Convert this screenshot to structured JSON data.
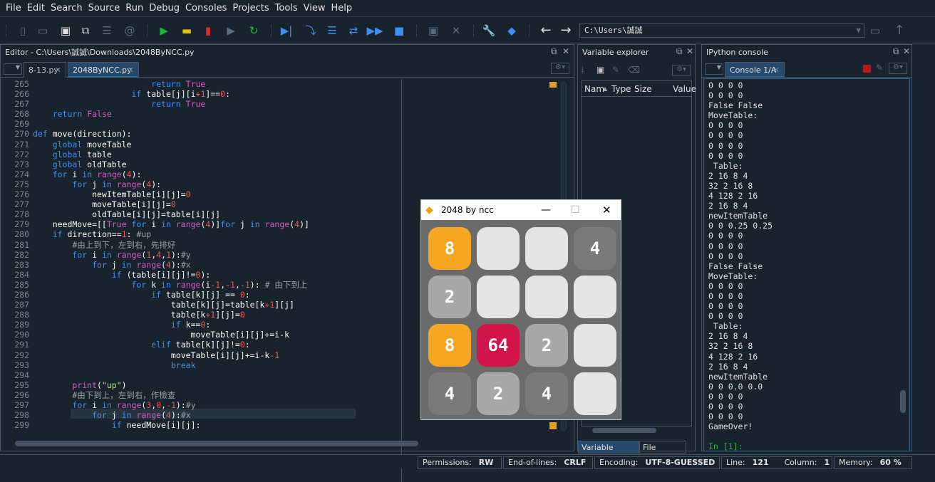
{
  "menu": [
    "File",
    "Edit",
    "Search",
    "Source",
    "Run",
    "Debug",
    "Consoles",
    "Projects",
    "Tools",
    "View",
    "Help"
  ],
  "toolbar": {
    "path": "C:\\Users\\誠誠"
  },
  "editor": {
    "title": "Editor - C:\\Users\\誠誠\\Downloads\\2048ByNCC.py",
    "tabs": [
      {
        "label": "8-13.py"
      },
      {
        "label": "2048ByNCC.py"
      }
    ],
    "lines": [
      {
        "n": "265",
        "t": "                        return True"
      },
      {
        "n": "266",
        "t": "                    if table[j][i+1]==0:"
      },
      {
        "n": "267",
        "t": "                        return True"
      },
      {
        "n": "268",
        "t": "    return False"
      },
      {
        "n": "269",
        "t": ""
      },
      {
        "n": "270",
        "t": "def move(direction):"
      },
      {
        "n": "271",
        "t": "    global moveTable"
      },
      {
        "n": "272",
        "t": "    global table"
      },
      {
        "n": "273",
        "t": "    global oldTable"
      },
      {
        "n": "274",
        "t": "    for i in range(4):"
      },
      {
        "n": "275",
        "t": "        for j in range(4):"
      },
      {
        "n": "276",
        "t": "            newItemTable[i][j]=0"
      },
      {
        "n": "277",
        "t": "            moveTable[i][j]=0"
      },
      {
        "n": "278",
        "t": "            oldTable[i][j]=table[i][j]"
      },
      {
        "n": "279",
        "t": "    needMove=[[True for i in range(4)]for j in range(4)]"
      },
      {
        "n": "280",
        "t": "    if direction==1: #up"
      },
      {
        "n": "281",
        "t": "        #由上到下，左到右，先排好"
      },
      {
        "n": "282",
        "t": "        for i in range(1,4,1):#y"
      },
      {
        "n": "283",
        "t": "            for j in range(4):#x"
      },
      {
        "n": "284",
        "t": "                if (table[i][j]!=0):"
      },
      {
        "n": "285",
        "t": "                    for k in range(i-1,-1,-1): # 由下到上"
      },
      {
        "n": "286",
        "t": "                        if table[k][j] == 0:"
      },
      {
        "n": "287",
        "t": "                            table[k][j]=table[k+1][j]"
      },
      {
        "n": "288",
        "t": "                            table[k+1][j]=0"
      },
      {
        "n": "289",
        "t": "                            if k==0:"
      },
      {
        "n": "290",
        "t": "                                moveTable[i][j]+=i-k"
      },
      {
        "n": "291",
        "t": "                        elif table[k][j]!=0:"
      },
      {
        "n": "292",
        "t": "                            moveTable[i][j]+=i-k-1"
      },
      {
        "n": "293",
        "t": "                            break"
      },
      {
        "n": "294",
        "t": ""
      },
      {
        "n": "295",
        "t": "        print(\"up\")"
      },
      {
        "n": "296",
        "t": "        #由下到上，左到右，作檢查"
      },
      {
        "n": "297",
        "t": "        for i in range(3,0,-1):#y"
      },
      {
        "n": "298",
        "t": "            for j in range(4):#x"
      },
      {
        "n": "299",
        "t": "                if needMove[i][j]:"
      }
    ]
  },
  "variable_explorer": {
    "title": "Variable explorer",
    "columns": [
      "Nam",
      "Type",
      "Size",
      "Value"
    ],
    "bottom_tabs": [
      "Variable explorer",
      "File explorer"
    ]
  },
  "ipython": {
    "title": "IPython console",
    "tab": "Console 1/A",
    "output": "0 0 0 0\n0 0 0 0\nFalse False\nMoveTable:\n0 0 0 0\n0 0 0 0\n0 0 0 0\n0 0 0 0\n Table:\n2 16 8 4\n32 2 16 8\n4 128 2 16\n2 16 8 4\nnewItemTable\n0 0 0.25 0.25\n0 0 0 0\n0 0 0 0\n0 0 0 0\nFalse False\nMoveTable:\n0 0 0 0\n0 0 0 0\n0 0 0 0\n0 0 0 0\n Table:\n2 16 8 4\n32 2 16 8\n4 128 2 16\n2 16 8 4\nnewItemTable\n0 0 0.0 0.0\n0 0 0 0\n0 0 0 0\n0 0 0 0\nGameOver!",
    "prompt": "In [1]:"
  },
  "status": {
    "permissions_label": "Permissions:",
    "permissions": "RW",
    "eol_label": "End-of-lines:",
    "eol": "CRLF",
    "encoding_label": "Encoding:",
    "encoding": "UTF-8-GUESSED",
    "line_label": "Line:",
    "line": "121",
    "column_label": "Column:",
    "column": "1",
    "memory_label": "Memory:",
    "memory": "60 %"
  },
  "game": {
    "title": "2048 by ncc",
    "grid": [
      [
        {
          "v": "8",
          "c": "#f5a623"
        },
        {
          "v": "",
          "c": "#e4e4e4"
        },
        {
          "v": "",
          "c": "#e4e4e4"
        },
        {
          "v": "4",
          "c": "#7a7a7a"
        }
      ],
      [
        {
          "v": "2",
          "c": "#a8a8a8"
        },
        {
          "v": "",
          "c": "#e4e4e4"
        },
        {
          "v": "",
          "c": "#e4e4e4"
        },
        {
          "v": "",
          "c": "#e4e4e4"
        }
      ],
      [
        {
          "v": "8",
          "c": "#f5a623"
        },
        {
          "v": "64",
          "c": "#d1144a"
        },
        {
          "v": "2",
          "c": "#a8a8a8"
        },
        {
          "v": "",
          "c": "#e4e4e4"
        }
      ],
      [
        {
          "v": "4",
          "c": "#7a7a7a"
        },
        {
          "v": "2",
          "c": "#a8a8a8"
        },
        {
          "v": "4",
          "c": "#7a7a7a"
        },
        {
          "v": "",
          "c": "#e4e4e4"
        }
      ]
    ]
  }
}
